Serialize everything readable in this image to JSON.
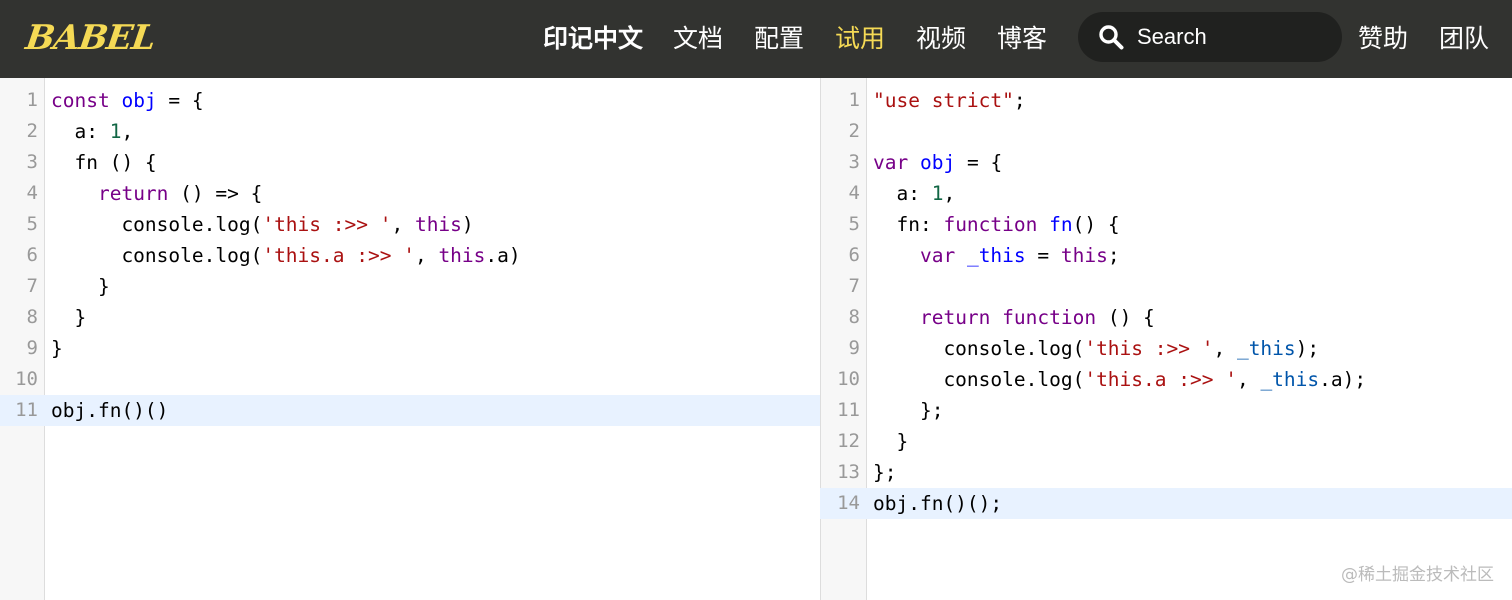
{
  "brand": {
    "logo_text": "BABEL",
    "logo_color": "#f5da55"
  },
  "nav": {
    "items": [
      {
        "id": "lang",
        "label": "印记中文"
      },
      {
        "id": "docs",
        "label": "文档"
      },
      {
        "id": "config",
        "label": "配置"
      },
      {
        "id": "try",
        "label": "试用"
      },
      {
        "id": "videos",
        "label": "视频"
      },
      {
        "id": "blog",
        "label": "博客"
      },
      {
        "id": "sponsor",
        "label": "赞助"
      },
      {
        "id": "team",
        "label": "团队"
      }
    ],
    "highlight_color": "#f5da55"
  },
  "search": {
    "placeholder": "Search"
  },
  "editor_input": {
    "lines": [
      {
        "n": "1",
        "tokens": [
          [
            "keyword",
            "const"
          ],
          [
            "plain",
            " "
          ],
          [
            "def",
            "obj"
          ],
          [
            "plain",
            " = {"
          ]
        ]
      },
      {
        "n": "2",
        "tokens": [
          [
            "plain",
            "  a: "
          ],
          [
            "number",
            "1"
          ],
          [
            "plain",
            ","
          ]
        ]
      },
      {
        "n": "3",
        "tokens": [
          [
            "plain",
            "  fn () {"
          ]
        ]
      },
      {
        "n": "4",
        "tokens": [
          [
            "plain",
            "    "
          ],
          [
            "keyword",
            "return"
          ],
          [
            "plain",
            " () => {"
          ]
        ]
      },
      {
        "n": "5",
        "tokens": [
          [
            "plain",
            "      console.log("
          ],
          [
            "string",
            "'this :>> '"
          ],
          [
            "plain",
            ", "
          ],
          [
            "keyword",
            "this"
          ],
          [
            "plain",
            ")"
          ]
        ]
      },
      {
        "n": "6",
        "tokens": [
          [
            "plain",
            "      console.log("
          ],
          [
            "string",
            "'this.a :>> '"
          ],
          [
            "plain",
            ", "
          ],
          [
            "keyword",
            "this"
          ],
          [
            "plain",
            ".a)"
          ]
        ]
      },
      {
        "n": "7",
        "tokens": [
          [
            "plain",
            "    }"
          ]
        ]
      },
      {
        "n": "8",
        "tokens": [
          [
            "plain",
            "  }"
          ]
        ]
      },
      {
        "n": "9",
        "tokens": [
          [
            "plain",
            "}"
          ]
        ]
      },
      {
        "n": "10",
        "tokens": []
      },
      {
        "n": "11",
        "tokens": [
          [
            "plain",
            "obj.fn()()"
          ]
        ],
        "active": true
      }
    ]
  },
  "editor_output": {
    "lines": [
      {
        "n": "1",
        "tokens": [
          [
            "string",
            "\"use strict\""
          ],
          [
            "plain",
            ";"
          ]
        ]
      },
      {
        "n": "2",
        "tokens": []
      },
      {
        "n": "3",
        "tokens": [
          [
            "keyword",
            "var"
          ],
          [
            "plain",
            " "
          ],
          [
            "def",
            "obj"
          ],
          [
            "plain",
            " = {"
          ]
        ]
      },
      {
        "n": "4",
        "tokens": [
          [
            "plain",
            "  a: "
          ],
          [
            "number",
            "1"
          ],
          [
            "plain",
            ","
          ]
        ]
      },
      {
        "n": "5",
        "tokens": [
          [
            "plain",
            "  fn: "
          ],
          [
            "keyword",
            "function"
          ],
          [
            "plain",
            " "
          ],
          [
            "def",
            "fn"
          ],
          [
            "plain",
            "() {"
          ]
        ]
      },
      {
        "n": "6",
        "tokens": [
          [
            "plain",
            "    "
          ],
          [
            "keyword",
            "var"
          ],
          [
            "plain",
            " "
          ],
          [
            "def",
            "_this"
          ],
          [
            "plain",
            " = "
          ],
          [
            "keyword",
            "this"
          ],
          [
            "plain",
            ";"
          ]
        ]
      },
      {
        "n": "7",
        "tokens": []
      },
      {
        "n": "8",
        "tokens": [
          [
            "plain",
            "    "
          ],
          [
            "keyword",
            "return"
          ],
          [
            "plain",
            " "
          ],
          [
            "keyword",
            "function"
          ],
          [
            "plain",
            " () {"
          ]
        ]
      },
      {
        "n": "9",
        "tokens": [
          [
            "plain",
            "      console.log("
          ],
          [
            "string",
            "'this :>> '"
          ],
          [
            "plain",
            ", "
          ],
          [
            "var2",
            "_this"
          ],
          [
            "plain",
            ");"
          ]
        ]
      },
      {
        "n": "10",
        "tokens": [
          [
            "plain",
            "      console.log("
          ],
          [
            "string",
            "'this.a :>> '"
          ],
          [
            "plain",
            ", "
          ],
          [
            "var2",
            "_this"
          ],
          [
            "plain",
            ".a);"
          ]
        ]
      },
      {
        "n": "11",
        "tokens": [
          [
            "plain",
            "    };"
          ]
        ]
      },
      {
        "n": "12",
        "tokens": [
          [
            "plain",
            "  }"
          ]
        ]
      },
      {
        "n": "13",
        "tokens": [
          [
            "plain",
            "};"
          ]
        ]
      },
      {
        "n": "14",
        "tokens": [
          [
            "plain",
            "obj.fn()();"
          ]
        ],
        "active": true
      }
    ]
  },
  "watermark": "@稀土掘金技术社区"
}
